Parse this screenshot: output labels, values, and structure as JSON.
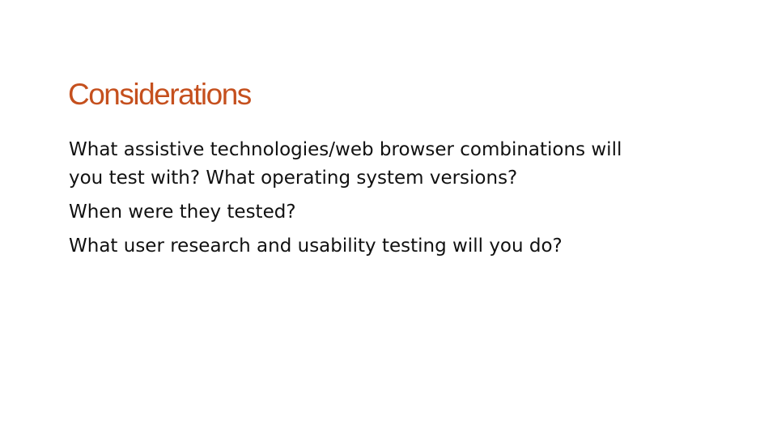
{
  "slide": {
    "title": "Considerations",
    "paragraphs": [
      "What assistive technologies/web browser combinations will you test with? What operating system versions?",
      "When were they tested?",
      "What user research and usability testing will you do?"
    ]
  },
  "colors": {
    "title": "#C5501E",
    "text": "#111111",
    "background": "#FFFFFF"
  }
}
